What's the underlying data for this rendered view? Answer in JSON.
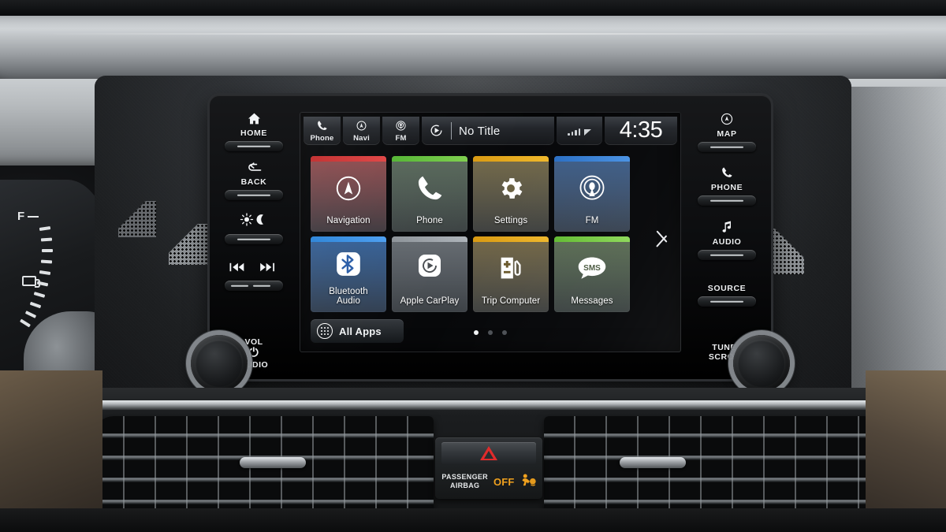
{
  "screen": {
    "status_bar": {
      "shortcuts": [
        {
          "icon": "phone-icon",
          "label": "Phone"
        },
        {
          "icon": "navi-compass-icon",
          "label": "Navi"
        },
        {
          "icon": "fm-radio-icon",
          "label": "FM"
        }
      ],
      "now_playing": {
        "icon": "play-circle-icon",
        "title": "No Title"
      },
      "signal": {
        "icon": "signal-bars-icon"
      },
      "clock": "4:35"
    },
    "apps": [
      {
        "label": "Navigation",
        "icon": "compass-icon",
        "accent": "#d33131",
        "tint": "#6d4a4f"
      },
      {
        "label": "Phone",
        "icon": "phone-handset-icon",
        "accent": "#5fbf3f",
        "tint": "#4e5a4e"
      },
      {
        "label": "Settings",
        "icon": "gear-icon",
        "accent": "#e8a81d",
        "tint": "#5e5a44"
      },
      {
        "label": "FM",
        "icon": "radio-waves-icon",
        "accent": "#2f7fd6",
        "tint": "#3f5878"
      },
      {
        "label": "Bluetooth Audio",
        "icon": "bluetooth-icon",
        "accent": "#2f8fe0",
        "tint": "#2f4d74"
      },
      {
        "label": "Apple CarPlay",
        "icon": "carplay-icon",
        "accent": "#9aa0a6",
        "tint": "#55595d"
      },
      {
        "label": "Trip Computer",
        "icon": "fuel-pump-icon",
        "accent": "#e8a81d",
        "tint": "#60563f"
      },
      {
        "label": "Messages",
        "icon": "sms-bubble-icon",
        "accent": "#7bc943",
        "tint": "#4d5a46"
      }
    ],
    "next_page_arrow": "chevron-right-icon",
    "all_apps": {
      "label": "All Apps",
      "icon": "grid-dots-icon"
    },
    "pagination": {
      "total": 3,
      "current": 1
    }
  },
  "hard_buttons": {
    "left": [
      {
        "label": "HOME",
        "icon": "home-icon",
        "glyph": "⌂"
      },
      {
        "label": "BACK",
        "icon": "back-arrow-icon",
        "glyph": "↩"
      },
      {
        "label": "",
        "icon": "brightness-day-night-icon",
        "glyph": "☀ ☾"
      },
      {
        "label": "",
        "icon": "track-skip-icon",
        "glyph": "⏮ ⏭"
      }
    ],
    "right": [
      {
        "label": "MAP",
        "icon": "map-compass-icon",
        "glyph": "◎"
      },
      {
        "label": "PHONE",
        "icon": "phone-icon",
        "glyph": "✆"
      },
      {
        "label": "AUDIO",
        "icon": "music-note-icon",
        "glyph": "♫"
      },
      {
        "label": "SOURCE",
        "icon": "source-icon",
        "glyph": ""
      }
    ],
    "volume_knob": {
      "line1": "VOL",
      "line2": "AUDIO",
      "icon": "power-icon",
      "glyph": "⏻"
    },
    "tune_knob": {
      "line1": "TUNE /",
      "line2": "SCROLL"
    }
  },
  "center_module": {
    "hazard": {
      "icon": "hazard-triangle-icon",
      "color": "#e02b2b"
    },
    "airbag_label_line1": "PASSENGER",
    "airbag_label_line2": "AIRBAG",
    "airbag_state": "OFF",
    "airbag_icon": "airbag-occupant-icon",
    "airbag_color": "#f0a11e"
  },
  "cluster": {
    "fuel_full_marker": "F"
  }
}
